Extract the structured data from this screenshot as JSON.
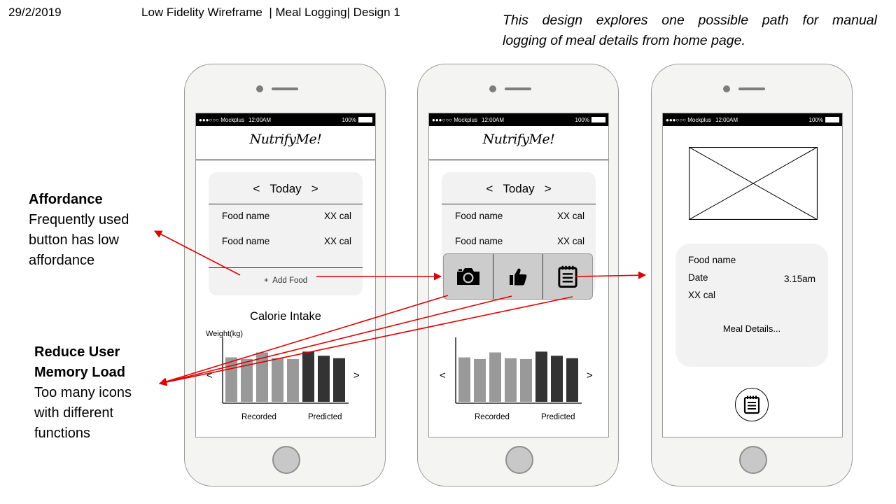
{
  "header": {
    "date": "29/2/2019",
    "title": "Low Fidelity Wireframe  | Meal Logging| Design 1",
    "description_line1": "This design explores one possible path for manual",
    "description_line2": "logging of meal details from home page."
  },
  "notes": {
    "affordance": {
      "heading": "Affordance",
      "line1": "Frequently used",
      "line2": "button has low",
      "line3": "affordance"
    },
    "memory": {
      "heading1": "Reduce User",
      "heading2": "Memory Load",
      "line1": "Too many icons",
      "line2": "with different",
      "line3": "functions"
    }
  },
  "status_bar": {
    "carrier": "●●●○○○ Mockplus",
    "time": "12:00AM",
    "battery": "100%"
  },
  "app": {
    "logo": "NutrifyMe!"
  },
  "home": {
    "prev_icon": "<",
    "day": "Today",
    "next_icon": ">",
    "foods": [
      {
        "name": "Food name",
        "cal": "XX cal"
      },
      {
        "name": "Food name",
        "cal": "XX cal"
      }
    ],
    "add_food": "+  Add Food"
  },
  "chart": {
    "title": "Calorie Intake",
    "ylabel": "Weight(kg)",
    "prev_icon": "<",
    "next_icon": ">",
    "legend_recorded": "Recorded",
    "legend_predicted": "Predicted"
  },
  "chart_data": {
    "type": "bar",
    "title": "Calorie Intake",
    "ylabel": "Weight(kg)",
    "series": [
      {
        "name": "Recorded",
        "values": [
          54,
          52,
          60,
          53,
          52
        ],
        "color": "#999999"
      },
      {
        "name": "Predicted",
        "values": [
          61,
          56,
          53
        ],
        "color": "#333333"
      }
    ],
    "ylim": [
      0,
      80
    ]
  },
  "popup": {
    "icons": [
      "camera-icon",
      "thumbs-up-icon",
      "notepad-icon"
    ]
  },
  "detail": {
    "food_name": "Food name",
    "date_label": "Date",
    "time": "3.15am",
    "cal": "XX cal",
    "meal_details": "Meal Details..."
  },
  "colors": {
    "arrow": "#e00000",
    "recorded": "#999999",
    "predicted": "#333333"
  }
}
